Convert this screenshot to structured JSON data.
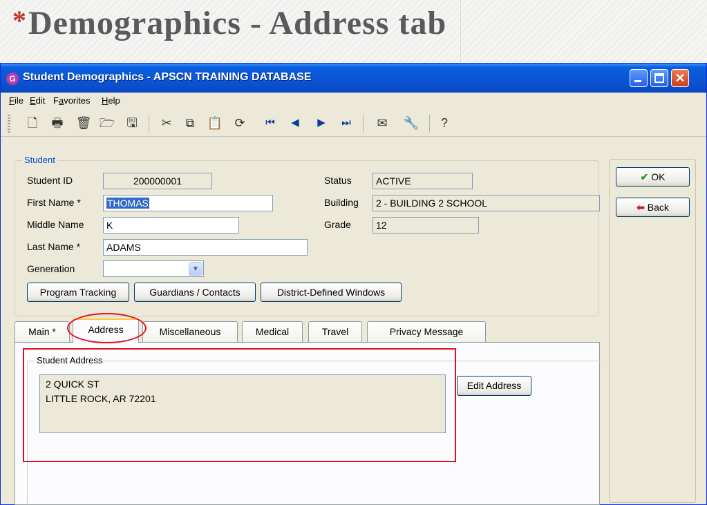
{
  "slide": {
    "asterisk": "*",
    "title": "Demographics - Address tab"
  },
  "window": {
    "title": "Student Demographics - APSCN TRAINING DATABASE",
    "icon_glyph": "G"
  },
  "menu": [
    {
      "pre": "",
      "u": "F",
      "post": "ile"
    },
    {
      "pre": "",
      "u": "E",
      "post": "dit"
    },
    {
      "pre": "F",
      "u": "a",
      "post": "vorites"
    },
    {
      "pre": "",
      "u": "H",
      "post": "elp"
    }
  ],
  "toolbar": {
    "icons": [
      "new-icon",
      "print-icon",
      "delete-icon",
      "open-icon",
      "save-icon",
      "cut-icon",
      "copy-icon",
      "paste-icon",
      "refresh-icon",
      "first-record-icon",
      "previous-record-icon",
      "next-record-icon",
      "last-record-icon",
      "email-icon",
      "tools-icon",
      "help-icon"
    ]
  },
  "student": {
    "group_label": "Student",
    "student_id_label": "Student ID",
    "student_id": "200000001",
    "first_name_label": "First Name *",
    "first_name": "THOMAS",
    "middle_name_label": "Middle Name",
    "middle_name": "K",
    "last_name_label": "Last Name *",
    "last_name": "ADAMS",
    "generation_label": "Generation",
    "generation": "",
    "status_label": "Status",
    "status": "ACTIVE",
    "building_label": "Building",
    "building": "2 - BUILDING 2 SCHOOL",
    "grade_label": "Grade",
    "grade": "12",
    "buttons": {
      "program_tracking": "Program Tracking",
      "guardians_contacts": "Guardians / Contacts",
      "district_defined": "District-Defined Windows"
    }
  },
  "actions": {
    "ok": "OK",
    "back": "Back"
  },
  "tabs": {
    "main": "Main *",
    "address": "Address",
    "miscellaneous": "Miscellaneous",
    "medical": "Medical",
    "travel": "Travel",
    "privacy": "Privacy Message"
  },
  "address": {
    "group_label": "Student Address",
    "line1": "2 QUICK ST",
    "line2": "LITTLE ROCK, AR  72201",
    "edit_button": "Edit Address"
  },
  "colors": {
    "highlight": "#e0101e",
    "titlebar": "#0a5fe0",
    "selection": "#316ac5"
  }
}
